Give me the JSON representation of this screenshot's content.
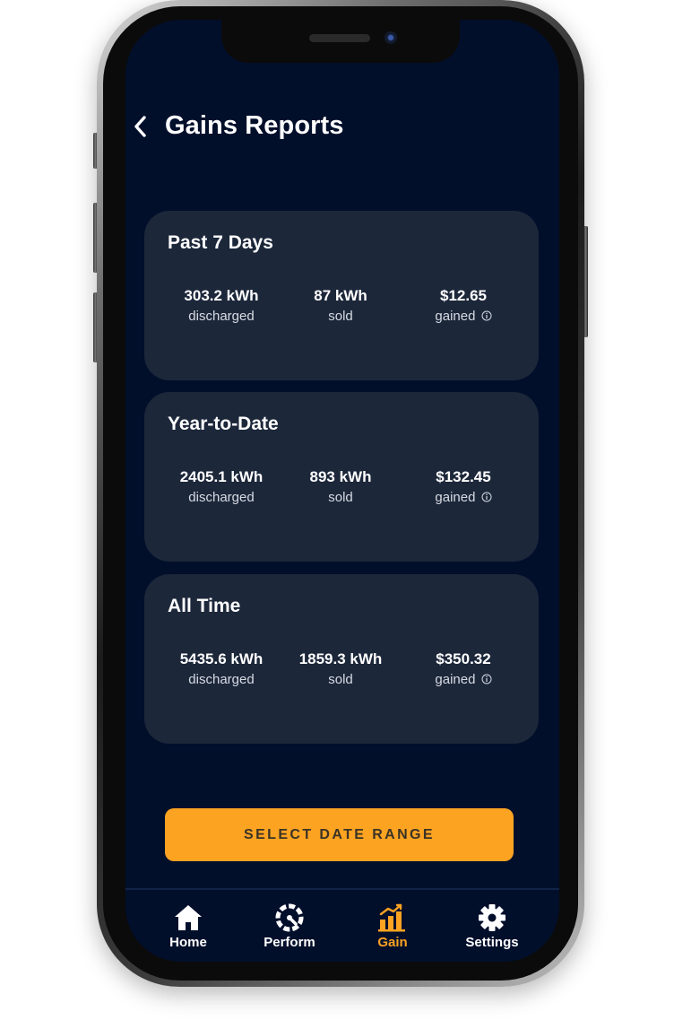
{
  "header": {
    "title": "Gains Reports",
    "back_icon": "chevron-left-icon"
  },
  "cards": [
    {
      "title": "Past 7 Days",
      "discharged_value": "303.2 kWh",
      "discharged_label": "discharged",
      "sold_value": "87 kWh",
      "sold_label": "sold",
      "gained_value": "$12.65",
      "gained_label": "gained"
    },
    {
      "title": "Year-to-Date",
      "discharged_value": "2405.1 kWh",
      "discharged_label": "discharged",
      "sold_value": "893 kWh",
      "sold_label": "sold",
      "gained_value": "$132.45",
      "gained_label": "gained"
    },
    {
      "title": "All Time",
      "discharged_value": "5435.6 kWh",
      "discharged_label": "discharged",
      "sold_value": "1859.3 kWh",
      "sold_label": "sold",
      "gained_value": "$350.32",
      "gained_label": "gained"
    }
  ],
  "actions": {
    "select_date_range": "SELECT DATE RANGE"
  },
  "tabs": [
    {
      "label": "Home",
      "icon": "home-icon",
      "active": false
    },
    {
      "label": "Perform",
      "icon": "gauge-icon",
      "active": false
    },
    {
      "label": "Gain",
      "icon": "bar-chart-icon",
      "active": true
    },
    {
      "label": "Settings",
      "icon": "gear-icon",
      "active": false
    }
  ],
  "colors": {
    "background": "#020f2b",
    "card": "#1c273a",
    "accent": "#fca322",
    "text": "#ffffff",
    "muted_text": "#d7dbe3"
  }
}
